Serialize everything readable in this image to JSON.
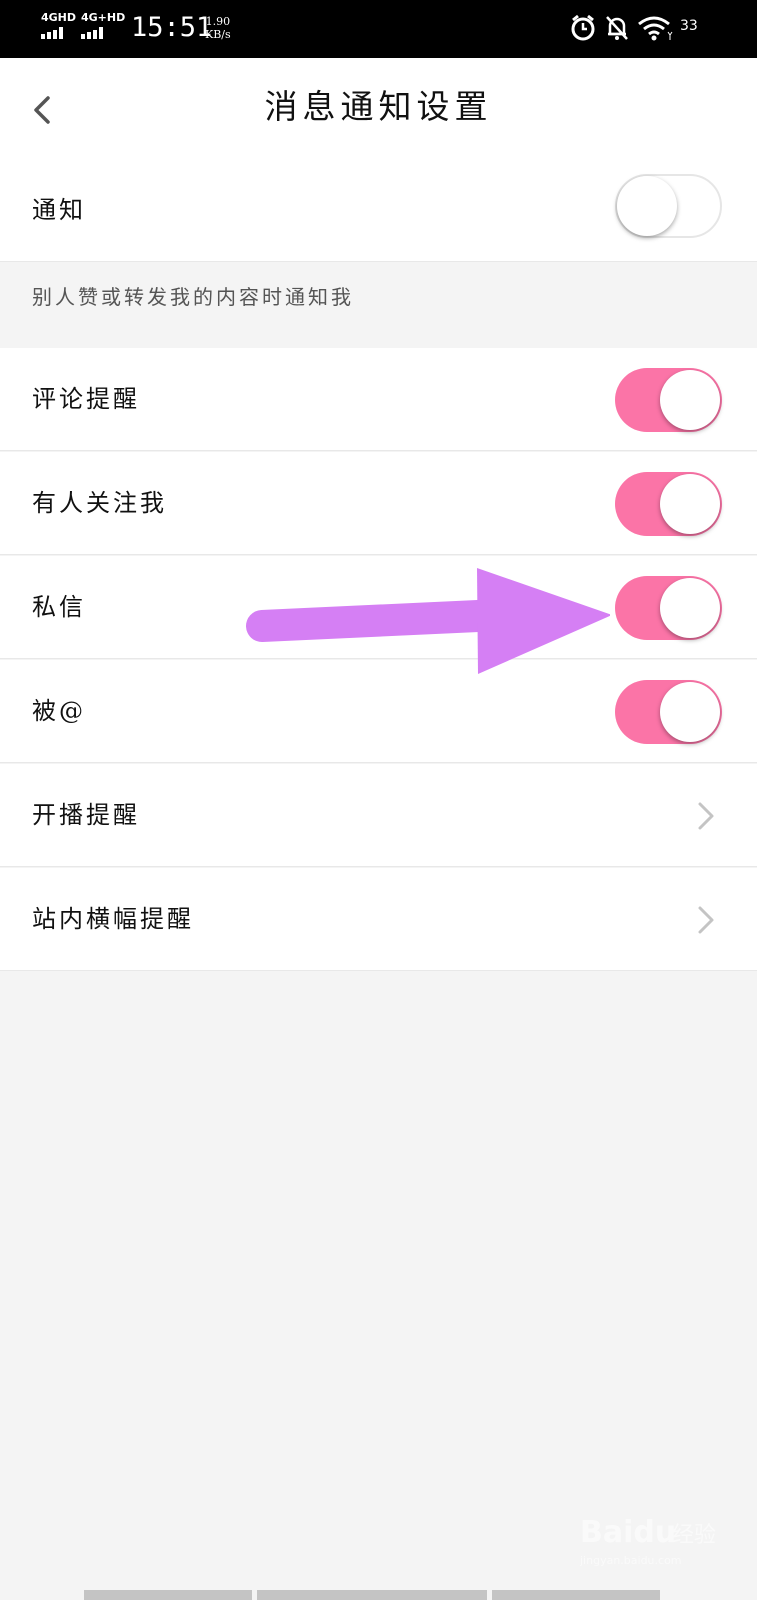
{
  "status_bar": {
    "signal1": "4GHD",
    "signal2": "4G+HD",
    "time": "15:51",
    "speed_value": "1.90",
    "speed_unit": "KB/s",
    "battery": "33",
    "icons": [
      "alarm-icon",
      "bell-off-icon",
      "wifi-icon"
    ]
  },
  "header": {
    "title": "消息通知设置",
    "back_icon": "chevron-left-icon"
  },
  "notify_row": {
    "label": "通知",
    "enabled": false
  },
  "section_hint": "别人赞或转发我的内容时通知我",
  "toggle_rows": [
    {
      "label": "评论提醒",
      "enabled": true
    },
    {
      "label": "有人关注我",
      "enabled": true
    },
    {
      "label": "私信",
      "enabled": true
    },
    {
      "label": "被@",
      "enabled": true
    }
  ],
  "link_rows": [
    {
      "label": "开播提醒",
      "icon": "chevron-right-icon"
    },
    {
      "label": "站内横幅提醒",
      "icon": "chevron-right-icon"
    }
  ],
  "colors": {
    "toggle_on": "#fb74a7",
    "annotation_arrow": "#d57ff4",
    "page_bg": "#f4f4f4"
  },
  "watermark": {
    "brand": "Baidu",
    "brand_cn": "经验",
    "url": "jingyan.baidu.com"
  }
}
